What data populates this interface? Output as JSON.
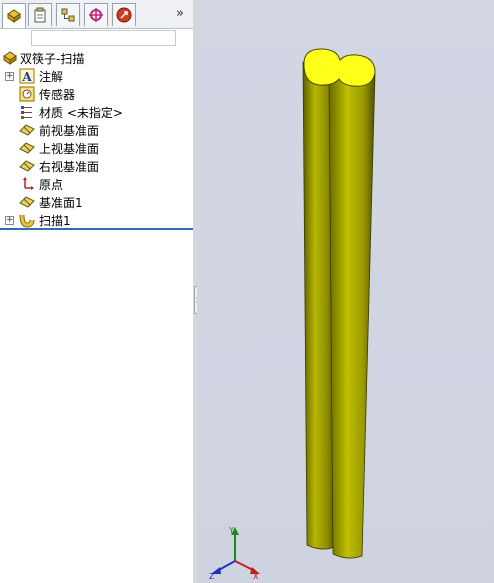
{
  "tabs": [
    {
      "name": "FeatureManager",
      "icon": "feature-manager-icon",
      "active": true
    },
    {
      "name": "PropertyManager",
      "icon": "property-manager-icon"
    },
    {
      "name": "ConfigurationManager",
      "icon": "configuration-manager-icon"
    },
    {
      "name": "DimXpertManager",
      "icon": "dimxpert-icon"
    },
    {
      "name": "DisplayManager",
      "icon": "display-manager-icon"
    }
  ],
  "more_tabs": "»",
  "tree": {
    "root": "双筷子-扫描",
    "items": [
      {
        "label": "注解",
        "icon": "annotation-icon",
        "expandable": true
      },
      {
        "label": "传感器",
        "icon": "sensor-icon",
        "expandable": false
      },
      {
        "label": "材质 <未指定>",
        "icon": "material-icon",
        "expandable": false
      },
      {
        "label": "前视基准面",
        "icon": "plane-icon",
        "expandable": false
      },
      {
        "label": "上视基准面",
        "icon": "plane-icon",
        "expandable": false
      },
      {
        "label": "右视基准面",
        "icon": "plane-icon",
        "expandable": false
      },
      {
        "label": "原点",
        "icon": "origin-icon",
        "expandable": false
      },
      {
        "label": "基准面1",
        "icon": "plane-icon",
        "expandable": false
      },
      {
        "label": "扫描1",
        "icon": "sweep-icon",
        "expandable": true
      }
    ]
  },
  "triad": {
    "x": "X",
    "y": "Y",
    "z": "Z"
  },
  "colors": {
    "model_body": "#8a8a00",
    "model_face": "#ffff1a",
    "accent_line": "#2f6db3"
  }
}
